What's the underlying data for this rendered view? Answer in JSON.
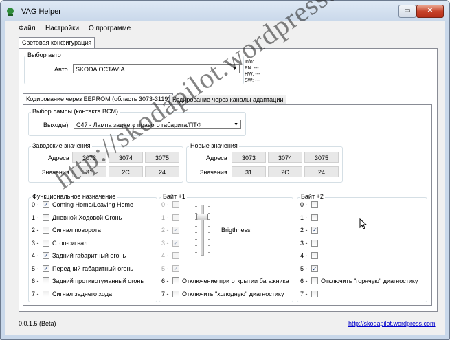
{
  "window": {
    "title": "VAG Helper",
    "controls": {
      "restore": "▭",
      "close": "✕"
    }
  },
  "menu": [
    "Файл",
    "Настройки",
    "О программе"
  ],
  "main_tab": "Световая конфигурация",
  "car_select": {
    "group_label": "Выбор авто",
    "field_label": "Авто",
    "value": "SKODA OCTAVIA",
    "info": [
      "Info:",
      "PN: ---",
      "HW: ---",
      "SW: ---"
    ]
  },
  "sub_tabs": [
    {
      "label": "Кодирование через EEPROM (область 3073-3119)",
      "active": true
    },
    {
      "label": "Кодирование через каналы адаптации",
      "active": false
    }
  ],
  "lamp_select": {
    "group_label": "Выбор лампы (контакта BCM)",
    "field_label": "Выходы)",
    "value": "C47 - Лампа заднего правого габарита/ПТФ"
  },
  "factory_values": {
    "group_label": "Заводские значения",
    "address_label": "Адреса",
    "value_label": "Значения",
    "addresses": [
      "3073",
      "3074",
      "3075"
    ],
    "values": [
      "31",
      "2C",
      "24"
    ]
  },
  "new_values": {
    "group_label": "Новые значения",
    "address_label": "Адреса",
    "value_label": "Значения",
    "addresses": [
      "3073",
      "3074",
      "3075"
    ],
    "values": [
      "31",
      "2C",
      "24"
    ]
  },
  "function_group": {
    "label": "Функциональное назначение",
    "items": [
      {
        "index": "0 -",
        "label": "Coming Home/Leaving Home",
        "checked": true
      },
      {
        "index": "1 -",
        "label": "Дневной Ходовой Огонь",
        "checked": false
      },
      {
        "index": "2 -",
        "label": "Сигнал поворота",
        "checked": false
      },
      {
        "index": "3 -",
        "label": "Стоп-сигнал",
        "checked": false
      },
      {
        "index": "4 -",
        "label": "Задний габаритный огонь",
        "checked": true
      },
      {
        "index": "5 -",
        "label": "Передний габаритный огонь",
        "checked": true
      },
      {
        "index": "6 -",
        "label": "Задний противотуманный огонь",
        "checked": false
      },
      {
        "index": "7 -",
        "label": "Сигнал заднего хода",
        "checked": false
      }
    ]
  },
  "byte1_group": {
    "label": "Байт +1",
    "brightness_label": "Brigthness",
    "items": [
      {
        "index": "0 -",
        "label": "",
        "checked": false,
        "dim": true
      },
      {
        "index": "1 -",
        "label": "",
        "checked": false,
        "dim": true
      },
      {
        "index": "2 -",
        "label": "",
        "checked": true,
        "dim": true
      },
      {
        "index": "3 -",
        "label": "",
        "checked": true,
        "dim": true
      },
      {
        "index": "4 -",
        "label": "",
        "checked": false,
        "dim": true
      },
      {
        "index": "5 -",
        "label": "",
        "checked": true,
        "dim": true
      },
      {
        "index": "6 -",
        "label": "Отключение при открытии багажника",
        "checked": false,
        "dim": false
      },
      {
        "index": "7 -",
        "label": "Отключить \"холодную\" диагностику",
        "checked": false,
        "dim": false
      }
    ]
  },
  "byte2_group": {
    "label": "Байт +2",
    "items": [
      {
        "index": "0 -",
        "label": "",
        "checked": false
      },
      {
        "index": "1 -",
        "label": "",
        "checked": false
      },
      {
        "index": "2 -",
        "label": "",
        "checked": true
      },
      {
        "index": "3 -",
        "label": "",
        "checked": false
      },
      {
        "index": "4 -",
        "label": "",
        "checked": false
      },
      {
        "index": "5 -",
        "label": "",
        "checked": true
      },
      {
        "index": "6 -",
        "label": "Отключить \"горячую\" диагностику",
        "checked": false
      },
      {
        "index": "7 -",
        "label": "",
        "checked": false
      }
    ]
  },
  "status": {
    "version": "0.0.1.5 (Beta)",
    "link": "http://skodapilot.wordpress.com"
  },
  "watermark": "http://skodapilot.wordpress.com",
  "colors": {
    "titlebar": "#c9d8ea",
    "client": "#f0f0f0",
    "link": "#0000cc",
    "close": "#c7432a"
  }
}
